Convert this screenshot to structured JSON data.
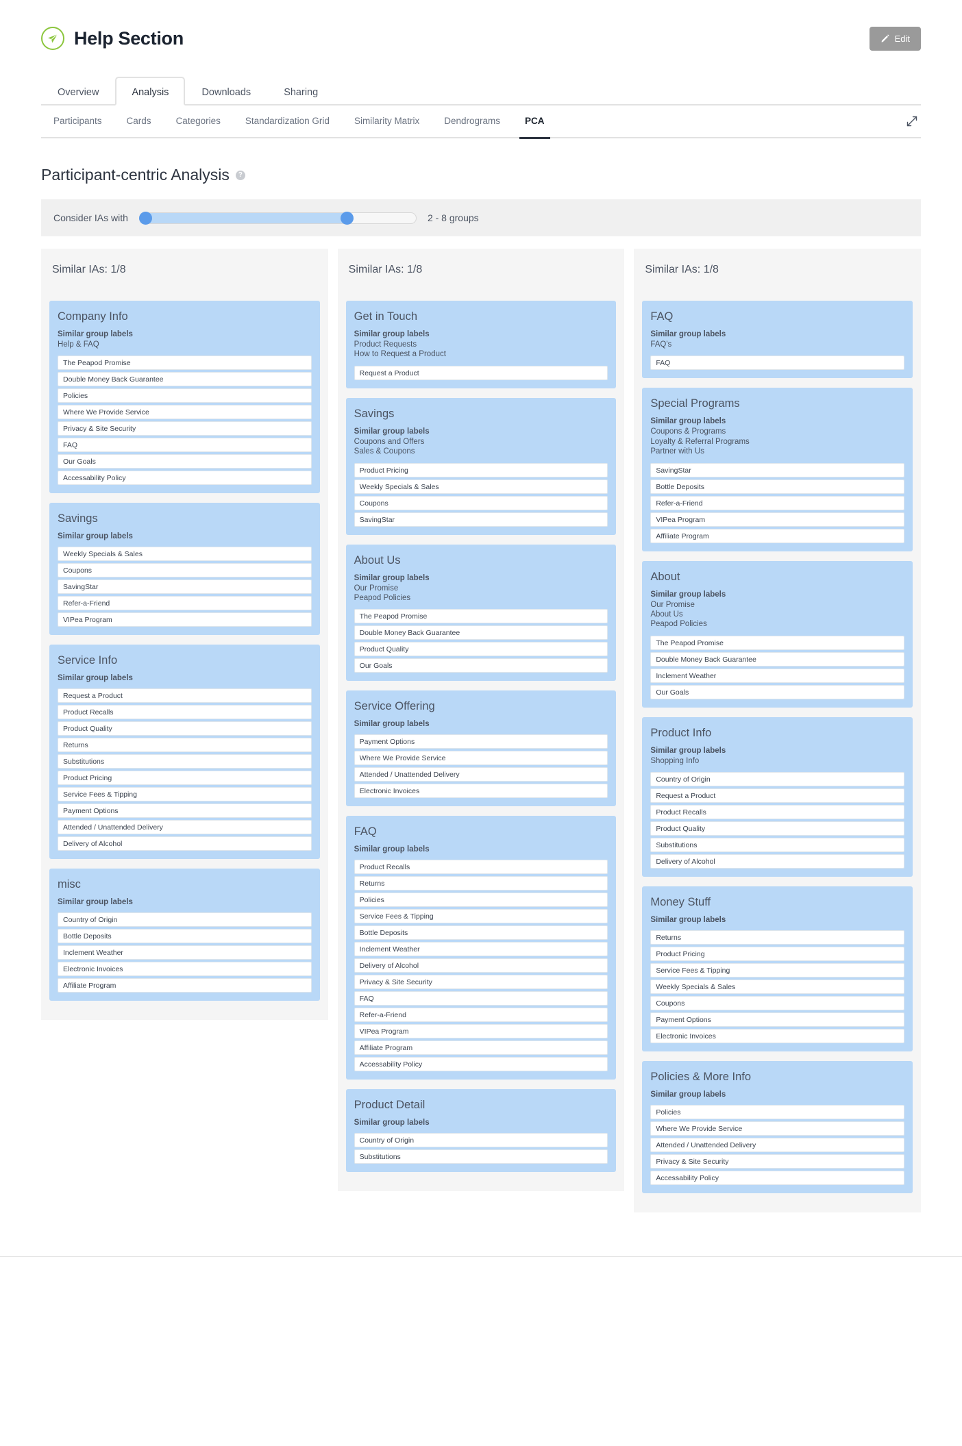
{
  "header": {
    "brand_title": "Help Section",
    "logo_icon": "paper-plane-circle-icon",
    "edit_label": "Edit",
    "edit_icon": "pencil-icon"
  },
  "primary_tabs": [
    {
      "label": "Overview",
      "active": false
    },
    {
      "label": "Analysis",
      "active": true
    },
    {
      "label": "Downloads",
      "active": false
    },
    {
      "label": "Sharing",
      "active": false
    }
  ],
  "secondary_tabs": [
    {
      "label": "Participants",
      "active": false
    },
    {
      "label": "Cards",
      "active": false
    },
    {
      "label": "Categories",
      "active": false
    },
    {
      "label": "Standardization Grid",
      "active": false
    },
    {
      "label": "Similarity Matrix",
      "active": false
    },
    {
      "label": "Dendrograms",
      "active": false
    },
    {
      "label": "PCA",
      "active": true
    }
  ],
  "expand_icon": "expand-diagonal-icon",
  "section": {
    "title": "Participant-centric Analysis",
    "help_icon": "question-mark-icon",
    "help_glyph": "?"
  },
  "slider": {
    "label": "Consider IAs with",
    "value_text": "2 - 8 groups",
    "min": 2,
    "max": 8
  },
  "columns": [
    {
      "header": "Similar IAs: 1/8",
      "groups": [
        {
          "name": "Company Info",
          "sub_head": "Similar group labels",
          "sub_items": [
            "Help & FAQ"
          ],
          "cards": [
            "The Peapod Promise",
            "Double Money Back Guarantee",
            "Policies",
            "Where We Provide Service",
            "Privacy & Site Security",
            "FAQ",
            "Our Goals",
            "Accessability Policy"
          ]
        },
        {
          "name": "Savings",
          "sub_head": "Similar group labels",
          "sub_items": [],
          "cards": [
            "Weekly Specials & Sales",
            "Coupons",
            "SavingStar",
            "Refer-a-Friend",
            "VIPea Program"
          ]
        },
        {
          "name": "Service Info",
          "sub_head": "Similar group labels",
          "sub_items": [],
          "cards": [
            "Request a Product",
            "Product Recalls",
            "Product Quality",
            "Returns",
            "Substitutions",
            "Product Pricing",
            "Service Fees & Tipping",
            "Payment Options",
            "Attended / Unattended Delivery",
            "Delivery of Alcohol"
          ]
        },
        {
          "name": "misc",
          "sub_head": "Similar group labels",
          "sub_items": [],
          "cards": [
            "Country of Origin",
            "Bottle Deposits",
            "Inclement Weather",
            "Electronic Invoices",
            "Affiliate Program"
          ]
        }
      ]
    },
    {
      "header": "Similar IAs: 1/8",
      "groups": [
        {
          "name": "Get in Touch",
          "sub_head": "Similar group labels",
          "sub_items": [
            "Product Requests",
            "How to Request a Product"
          ],
          "cards": [
            "Request a Product"
          ]
        },
        {
          "name": "Savings",
          "sub_head": "Similar group labels",
          "sub_items": [
            "Coupons and Offers",
            "Sales & Coupons"
          ],
          "cards": [
            "Product Pricing",
            "Weekly Specials & Sales",
            "Coupons",
            "SavingStar"
          ]
        },
        {
          "name": "About Us",
          "sub_head": "Similar group labels",
          "sub_items": [
            "Our Promise",
            "Peapod Policies"
          ],
          "cards": [
            "The Peapod Promise",
            "Double Money Back Guarantee",
            "Product Quality",
            "Our Goals"
          ]
        },
        {
          "name": "Service Offering",
          "sub_head": "Similar group labels",
          "sub_items": [],
          "cards": [
            "Payment Options",
            "Where We Provide Service",
            "Attended / Unattended Delivery",
            "Electronic Invoices"
          ]
        },
        {
          "name": "FAQ",
          "sub_head": "Similar group labels",
          "sub_items": [],
          "cards": [
            "Product Recalls",
            "Returns",
            "Policies",
            "Service Fees & Tipping",
            "Bottle Deposits",
            "Inclement Weather",
            "Delivery of Alcohol",
            "Privacy & Site Security",
            "FAQ",
            "Refer-a-Friend",
            "VIPea Program",
            "Affiliate Program",
            "Accessability Policy"
          ]
        },
        {
          "name": "Product Detail",
          "sub_head": "Similar group labels",
          "sub_items": [],
          "cards": [
            "Country of Origin",
            "Substitutions"
          ]
        }
      ]
    },
    {
      "header": "Similar IAs: 1/8",
      "groups": [
        {
          "name": "FAQ",
          "sub_head": "Similar group labels",
          "sub_items": [
            "FAQ's"
          ],
          "cards": [
            "FAQ"
          ]
        },
        {
          "name": "Special Programs",
          "sub_head": "Similar group labels",
          "sub_items": [
            "Coupons & Programs",
            "Loyalty & Referral Programs",
            "Partner with Us"
          ],
          "cards": [
            "SavingStar",
            "Bottle Deposits",
            "Refer-a-Friend",
            "VIPea Program",
            "Affiliate Program"
          ]
        },
        {
          "name": "About",
          "sub_head": "Similar group labels",
          "sub_items": [
            "Our Promise",
            "About Us",
            "Peapod Policies"
          ],
          "cards": [
            "The Peapod Promise",
            "Double Money Back Guarantee",
            "Inclement Weather",
            "Our Goals"
          ]
        },
        {
          "name": "Product Info",
          "sub_head": "Similar group labels",
          "sub_items": [
            "Shopping Info"
          ],
          "cards": [
            "Country of Origin",
            "Request a Product",
            "Product Recalls",
            "Product Quality",
            "Substitutions",
            "Delivery of Alcohol"
          ]
        },
        {
          "name": "Money Stuff",
          "sub_head": "Similar group labels",
          "sub_items": [],
          "cards": [
            "Returns",
            "Product Pricing",
            "Service Fees & Tipping",
            "Weekly Specials & Sales",
            "Coupons",
            "Payment Options",
            "Electronic Invoices"
          ]
        },
        {
          "name": "Policies & More Info",
          "sub_head": "Similar group labels",
          "sub_items": [],
          "cards": [
            "Policies",
            "Where We Provide Service",
            "Attended / Unattended Delivery",
            "Privacy & Site Security",
            "Accessability Policy"
          ]
        }
      ]
    }
  ],
  "colors": {
    "brand_green": "#8cc63e",
    "card_blue": "#b9d8f7",
    "slider_blue": "#5b9bea",
    "column_bg": "#f5f5f5"
  }
}
